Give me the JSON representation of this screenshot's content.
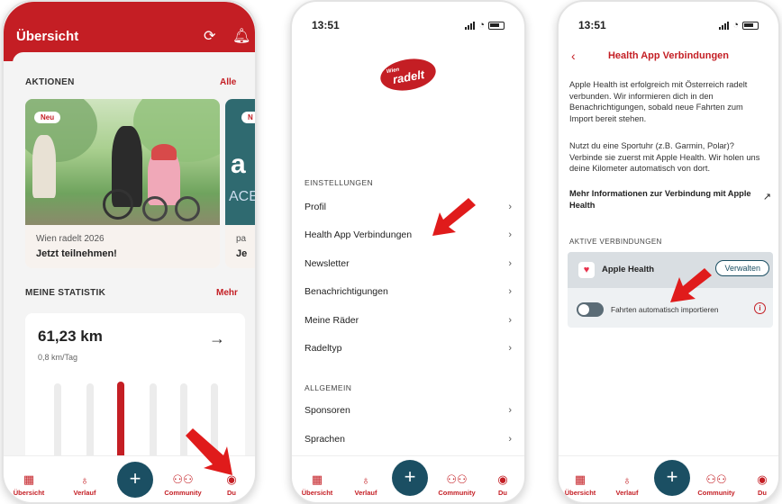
{
  "screen1": {
    "header_title": "Übersicht",
    "actions_label": "AKTIONEN",
    "actions_link": "Alle",
    "card1": {
      "badge": "Neu",
      "subtitle": "Wien radelt 2026",
      "title": "Jetzt teilnehmen!"
    },
    "card2": {
      "badge": "N",
      "subtitle": "pa",
      "title": "Je",
      "photo_text": "a",
      "photo_text2": "ACE"
    },
    "stats_label": "MEINE STATISTIK",
    "stats_link": "Mehr",
    "km_total": "61,23 km",
    "km_per_day": "0,8 km/Tag",
    "nav": [
      "Übersicht",
      "Verlauf",
      "Community",
      "Du"
    ]
  },
  "screen2": {
    "time": "13:51",
    "logo_small": "Wien",
    "logo_text": "radelt",
    "section_settings": "EINSTELLUNGEN",
    "settings_items": [
      "Profil",
      "Health App Verbindungen",
      "Newsletter",
      "Benachrichtigungen",
      "Meine Räder",
      "Radeltyp"
    ],
    "section_general": "ALLGEMEIN",
    "general_items": [
      "Sponsoren",
      "Sprachen"
    ],
    "nav": [
      "Übersicht",
      "Verlauf",
      "Community",
      "Du"
    ]
  },
  "screen3": {
    "time": "13:51",
    "title": "Health App Verbindungen",
    "para1": "Apple Health ist erfolgreich mit Österreich radelt verbunden. Wir informieren dich in den Benachrichtigungen, sobald neue Fahrten zum Import bereit stehen.",
    "para2": "Nutzt du eine Sportuhr (z.B. Garmin, Polar)? Verbinde sie zuerst mit Apple Health. Wir holen uns deine Kilometer automatisch von dort.",
    "info_link": "Mehr Informationen zur Verbindung mit Apple Health",
    "active_label": "AKTIVE VERBINDUNGEN",
    "connection_name": "Apple Health",
    "manage_button": "Verwalten",
    "toggle_label": "Fahrten automatisch importieren",
    "nav": [
      "Übersicht",
      "Verlauf",
      "Community",
      "Du"
    ]
  },
  "colors": {
    "brand_red": "#c41e24",
    "fab_blue": "#1b4f63",
    "arrow_red": "#e01b1b"
  }
}
